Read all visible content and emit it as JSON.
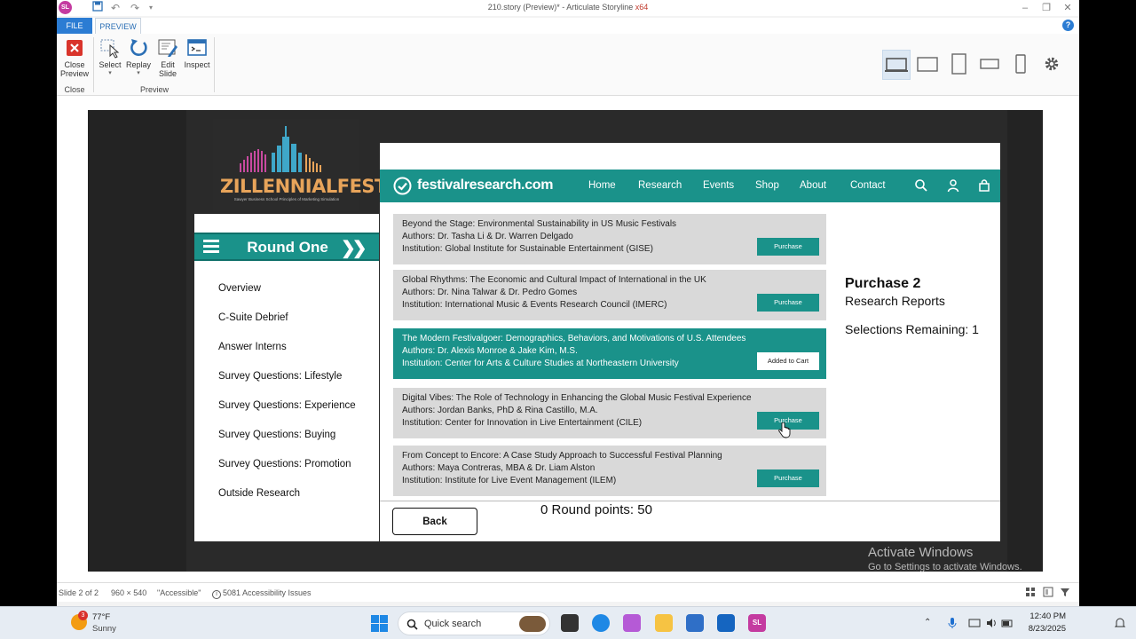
{
  "window": {
    "title": "210.story (Preview)* - Articulate Storyline",
    "title_arch": "x64",
    "app_icon": "SL"
  },
  "ribbon": {
    "tabs": [
      "FILE",
      "PREVIEW"
    ],
    "close_preview": "Close\nPreview",
    "select": "Select",
    "replay": "Replay",
    "edit_slide": "Edit\nSlide",
    "inspect": "Inspect",
    "group_close": "Close",
    "group_preview": "Preview"
  },
  "slide": {
    "logo_text": "ZILLENNIALFEST",
    "logo_sub": "Sawyer Business School Principles of Marketing Simulation",
    "round_title": "Round One",
    "nav": [
      "Overview",
      "C-Suite Debrief",
      "Answer Interns",
      "Survey Questions: Lifestyle",
      "Survey Questions: Experience",
      "Survey Questions: Buying",
      "Survey Questions: Promotion",
      "Outside Research"
    ],
    "site": {
      "name": "festivalresearch.com",
      "nav": [
        "Home",
        "Research",
        "Events",
        "Shop",
        "About",
        "Contact"
      ]
    },
    "reports": [
      {
        "title": "Beyond the Stage: Environmental Sustainability in US Music Festivals",
        "authors": "Authors: Dr. Tasha Li & Dr. Warren Delgado",
        "institution": "Institution: Global Institute for Sustainable Entertainment (GISE)",
        "button": "Purchase"
      },
      {
        "title": "Global Rhythms: The Economic and Cultural Impact of International in the UK",
        "authors": "Authors: Dr. Nina Talwar & Dr. Pedro Gomes",
        "institution": "Institution: International Music & Events Research Council (IMERC)",
        "button": "Purchase"
      },
      {
        "title": "The Modern Festivalgoer: Demographics, Behaviors, and Motivations of U.S. Attendees",
        "authors": "Authors: Dr. Alexis Monroe & Jake Kim, M.S.",
        "institution": "Institution: Center for Arts & Culture Studies at Northeastern University",
        "button": "Added to Cart"
      },
      {
        "title": "Digital Vibes: The Role of Technology in Enhancing the Global Music Festival Experience",
        "authors": "Authors: Jordan Banks, PhD & Rina Castillo, M.A.",
        "institution": "Institution: Center for Innovation in Live Entertainment (CILE)",
        "button": "Purchase"
      },
      {
        "title": "From Concept to Encore: A Case Study Approach to Successful Festival Planning",
        "authors": "Authors: Maya Contreras, MBA & Dr. Liam Alston",
        "institution": "Institution: Institute for Live Event Management (ILEM)",
        "button": "Purchase"
      }
    ],
    "purchase_title": "Purchase 2",
    "purchase_sub": "Research Reports",
    "selections": "Selections Remaining: 1",
    "back": "Back",
    "points": "0 Round points: 50"
  },
  "watermark": {
    "line1": "Activate Windows",
    "line2": "Go to Settings to activate Windows."
  },
  "statusbar": {
    "slide": "Slide 2 of 2",
    "size": "960 × 540",
    "accessible": "\"Accessible\"",
    "issues": "5081 Accessibility Issues"
  },
  "taskbar": {
    "weather_badge": "3",
    "temp": "77°F",
    "weather": "Sunny",
    "search": "Quick search",
    "time": "12:40 PM",
    "date": "8/23/2025"
  },
  "colors": {
    "teal": "#1a928a",
    "card_gray": "#d9d9d9",
    "file_tab": "#2b7cd3"
  }
}
